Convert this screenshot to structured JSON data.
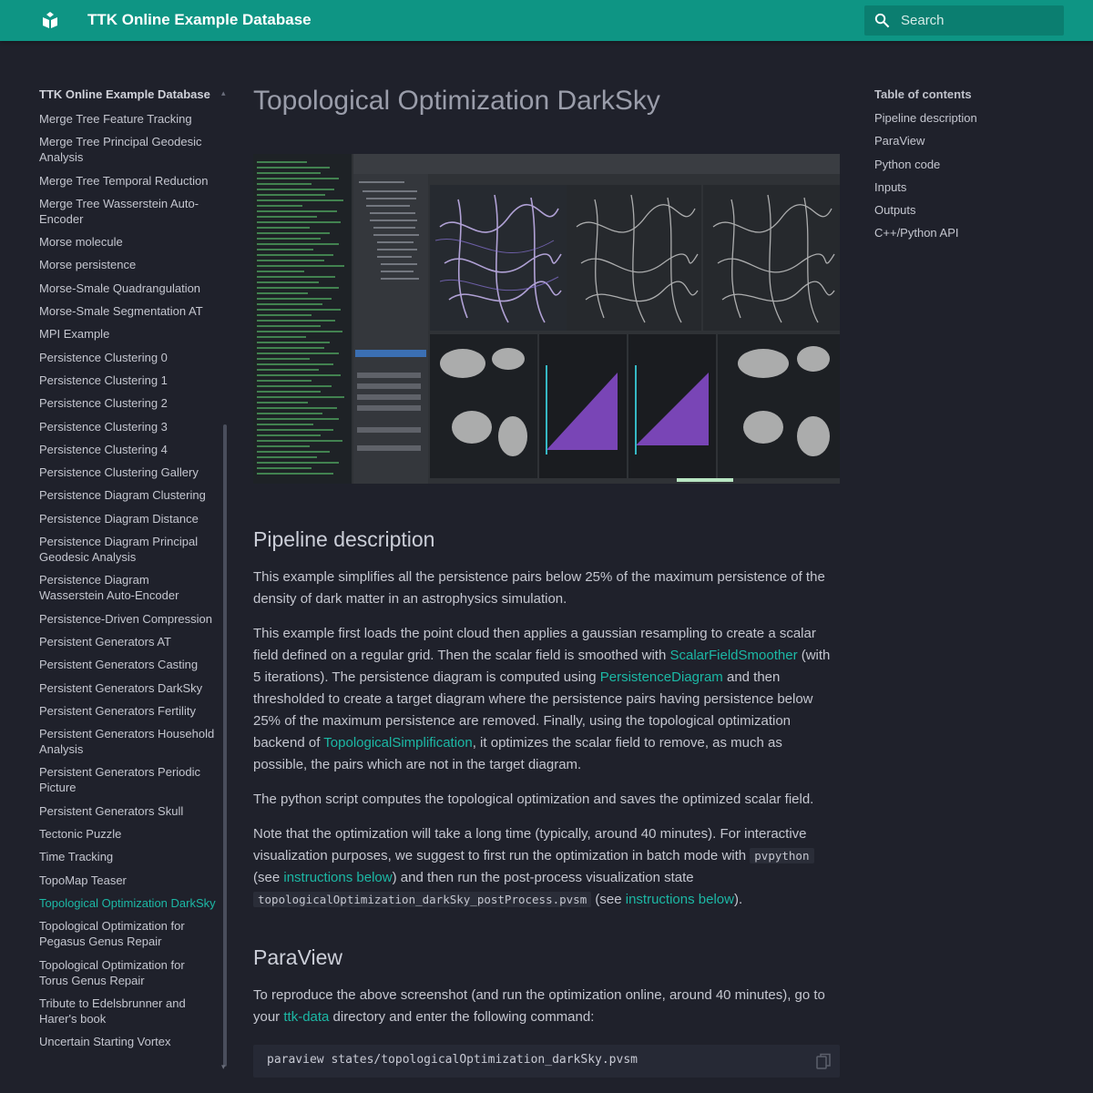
{
  "header": {
    "site_title": "TTK Online Example Database",
    "search_placeholder": "Search",
    "logo_icon": "ttk-logo-icon",
    "search_icon": "search-icon"
  },
  "colors": {
    "header_bg": "#0e9584",
    "page_bg": "#1f212b",
    "link": "#1cb8a5"
  },
  "nav": {
    "title": "TTK Online Example Database",
    "items": [
      "Merge Tree Feature Tracking",
      "Merge Tree Principal Geodesic Analysis",
      "Merge Tree Temporal Reduction",
      "Merge Tree Wasserstein Auto-Encoder",
      "Morse molecule",
      "Morse persistence",
      "Morse-Smale Quadrangulation",
      "Morse-Smale Segmentation AT",
      "MPI Example",
      "Persistence Clustering 0",
      "Persistence Clustering 1",
      "Persistence Clustering 2",
      "Persistence Clustering 3",
      "Persistence Clustering 4",
      "Persistence Clustering Gallery",
      "Persistence Diagram Clustering",
      "Persistence Diagram Distance",
      "Persistence Diagram Principal Geodesic Analysis",
      "Persistence Diagram Wasserstein Auto-Encoder",
      "Persistence-Driven Compression",
      "Persistent Generators AT",
      "Persistent Generators Casting",
      "Persistent Generators DarkSky",
      "Persistent Generators Fertility",
      "Persistent Generators Household Analysis",
      "Persistent Generators Periodic Picture",
      "Persistent Generators Skull",
      "Tectonic Puzzle",
      "Time Tracking",
      "TopoMap Teaser",
      "Topological Optimization DarkSky",
      "Topological Optimization for Pegasus Genus Repair",
      "Topological Optimization for Torus Genus Repair",
      "Tribute to Edelsbrunner and Harer's book",
      "Uncertain Starting Vortex"
    ],
    "active_item": "Topological Optimization DarkSky"
  },
  "main": {
    "title": "Topological Optimization DarkSky",
    "pipeline": {
      "heading": "Pipeline description",
      "p1": "This example simplifies all the persistence pairs below 25% of the maximum persistence of the density of dark matter in an astrophysics simulation.",
      "p2_a": "This example first loads the point cloud then applies a gaussian resampling to create a scalar field defined on a regular grid. Then the scalar field is smoothed with ",
      "p2_link1": "ScalarFieldSmoother",
      "p2_b": " (with 5 iterations). The persistence diagram is computed using ",
      "p2_link2": "PersistenceDiagram",
      "p2_c": " and then thresholded to create a target diagram where the persistence pairs having persistence below 25% of the maximum persistence are removed. Finally, using the topological optimization backend of ",
      "p2_link3": "TopologicalSimplification",
      "p2_d": ", it optimizes the scalar field to remove, as much as possible, the pairs which are not in the target diagram.",
      "p3": "The python script computes the topological optimization and saves the optimized scalar field.",
      "p4_a": "Note that the optimization will take a long time (typically, around 40 minutes). For interactive visualization purposes, we suggest to first run the optimization in batch mode with ",
      "p4_code1": "pvpython",
      "p4_b": " (see ",
      "p4_link1": "instructions below",
      "p4_c": ") and then run the post-process visualization state ",
      "p4_code2": "topologicalOptimization_darkSky_postProcess.pvsm",
      "p4_d": " (see ",
      "p4_link2": "instructions below",
      "p4_e": ")."
    },
    "paraview": {
      "heading": "ParaView",
      "p1_a": "To reproduce the above screenshot (and run the optimization online, around 40 minutes), go to your ",
      "p1_link": "ttk-data",
      "p1_b": " directory and enter the following command:",
      "code": "paraview states/topologicalOptimization_darkSky.pvsm",
      "copy_icon": "copy-icon"
    }
  },
  "toc": {
    "title": "Table of contents",
    "items": [
      "Pipeline description",
      "ParaView",
      "Python code",
      "Inputs",
      "Outputs",
      "C++/Python API"
    ]
  }
}
